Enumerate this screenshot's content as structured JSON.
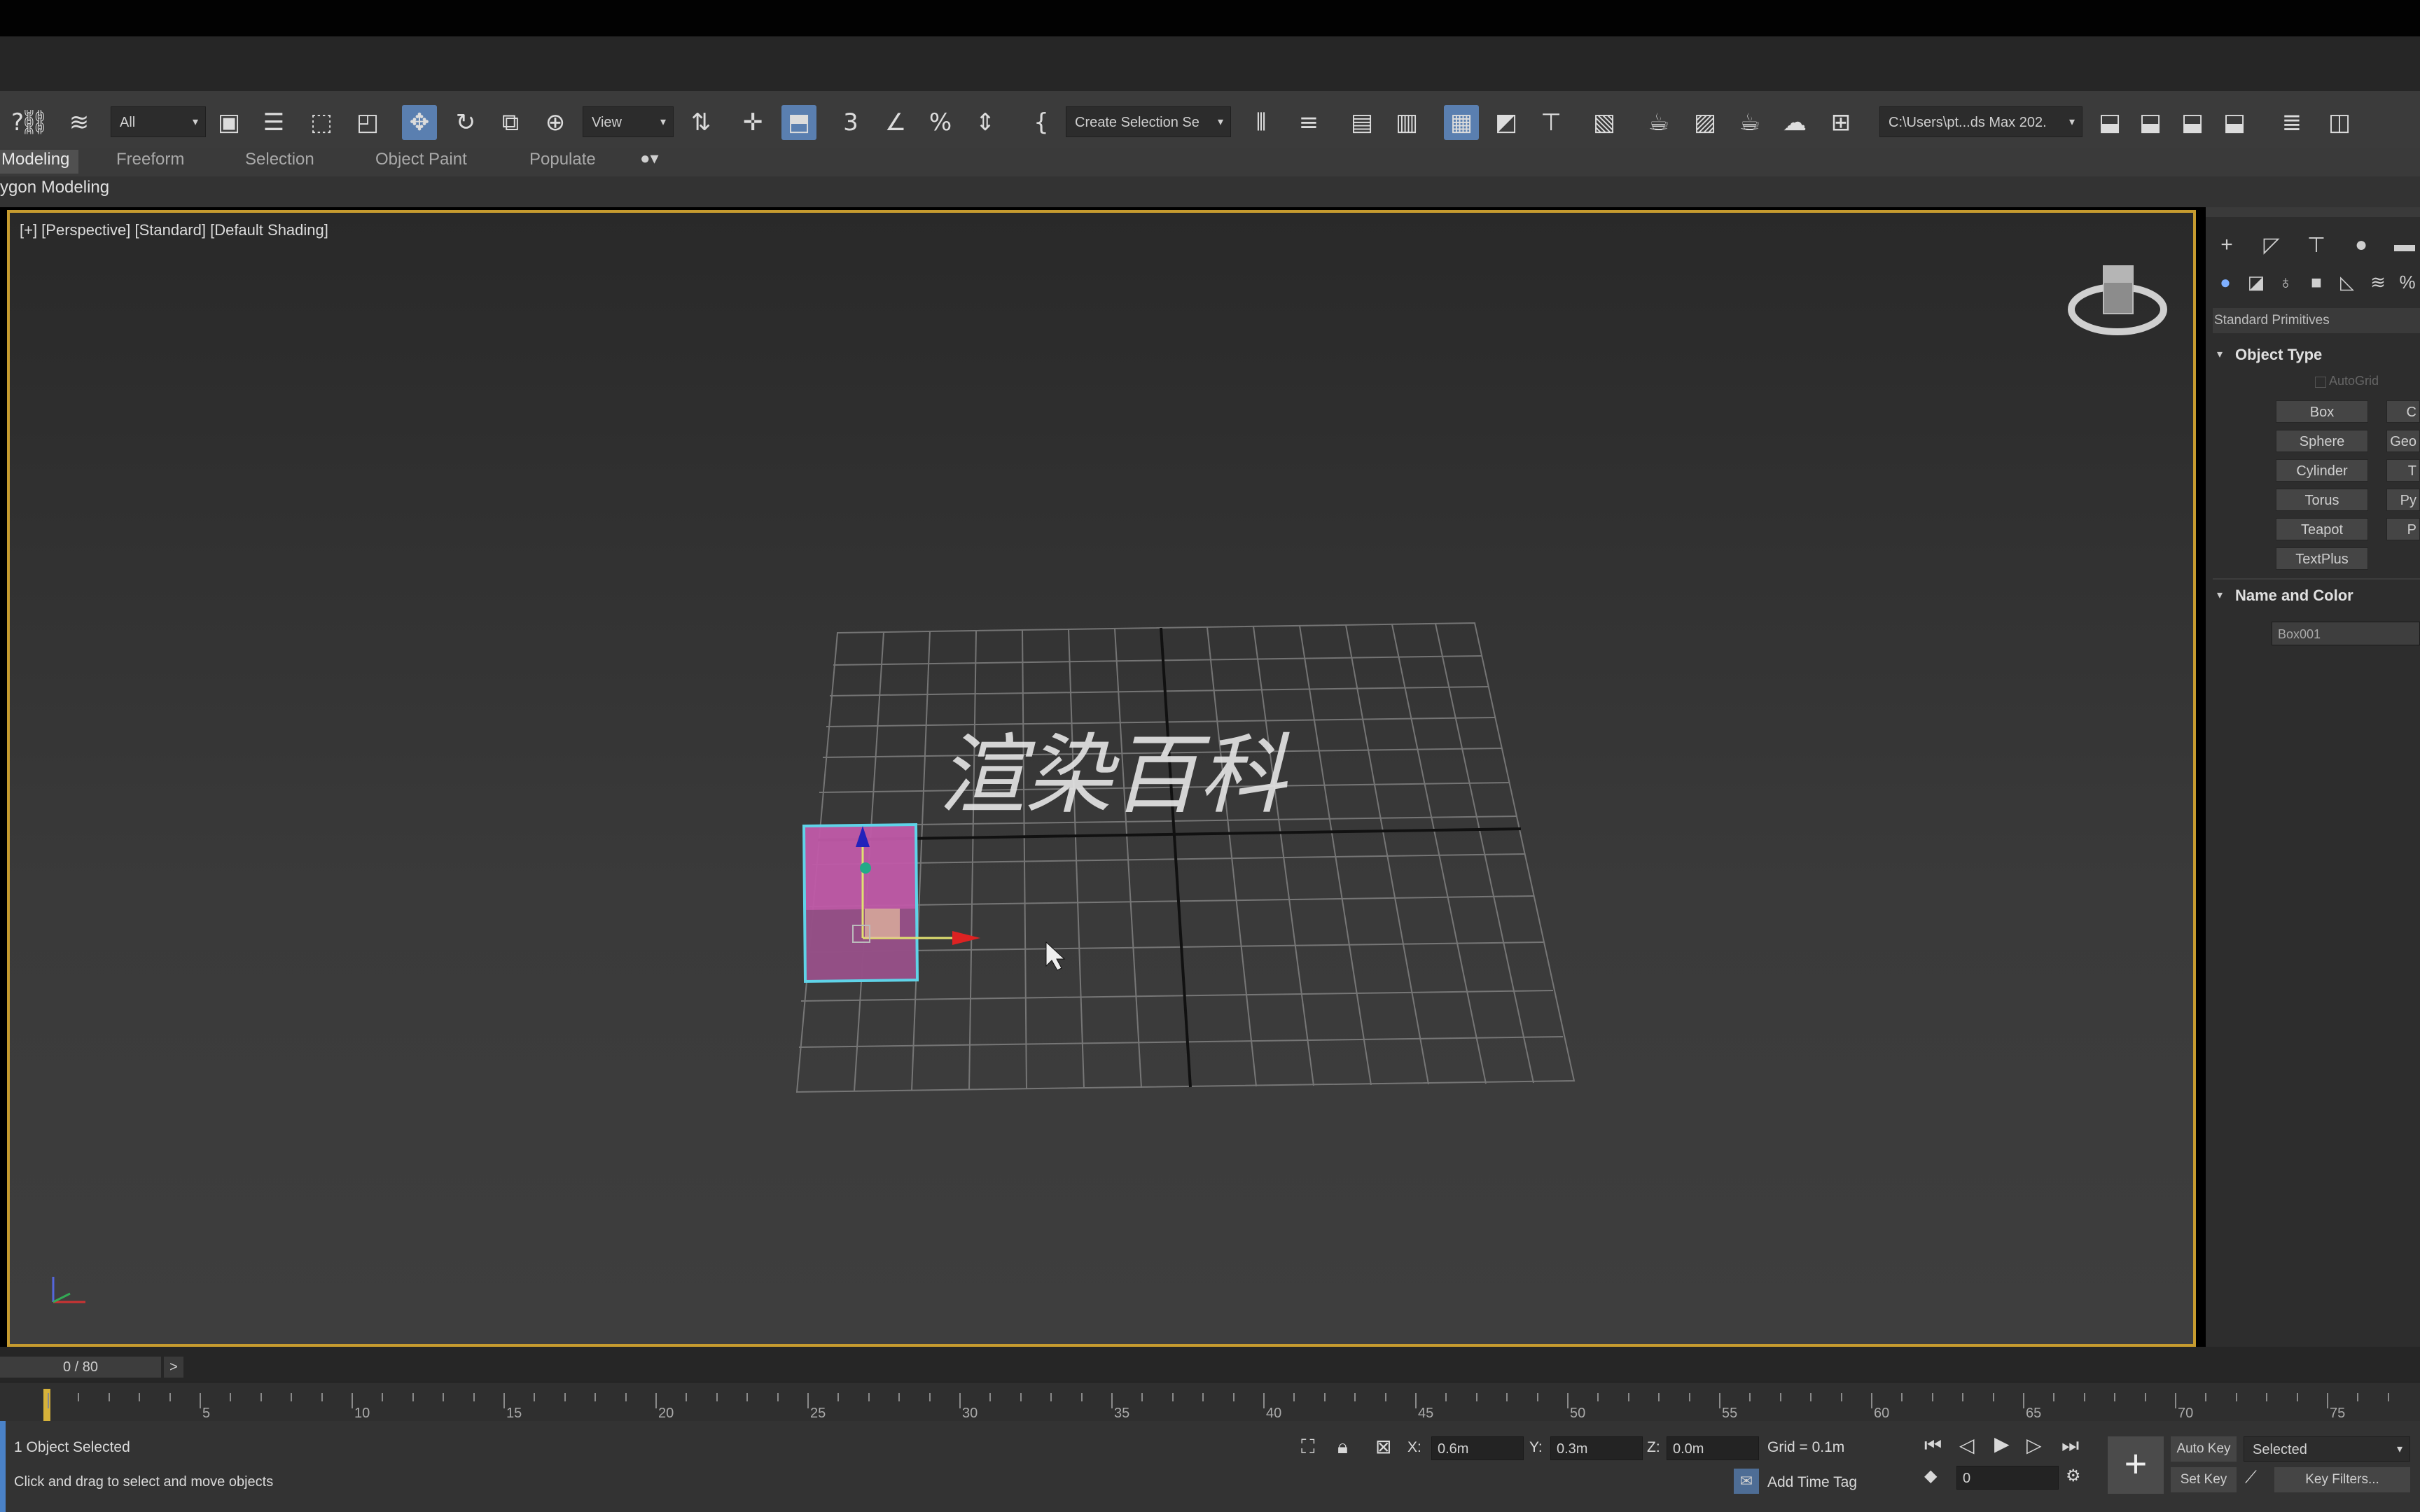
{
  "toolbar": {
    "selection_filter": "All",
    "ref_coord": "View",
    "named_selection": "Create Selection Se",
    "project_path": "C:\\Users\\pt...ds Max 202."
  },
  "ribbon": {
    "tabs": [
      "Modeling",
      "Freeform",
      "Selection",
      "Object Paint",
      "Populate"
    ],
    "subtitle": "ygon Modeling"
  },
  "viewport": {
    "label": "[+] [Perspective] [Standard] [Default Shading]",
    "watermark": "渲染百科"
  },
  "command_panel": {
    "category": "Standard Primitives",
    "object_type_header": "Object Type",
    "autogrid": "AutoGrid",
    "buttons": [
      "Box",
      "Sphere",
      "Cylinder",
      "Torus",
      "Teapot",
      "TextPlus"
    ],
    "buttons_col2": [
      "C",
      "Geo",
      "T",
      "Py",
      "P"
    ],
    "name_color_header": "Name and Color",
    "object_name": "Box001"
  },
  "timeline": {
    "frame_indicator": "0 / 80",
    "ticks": [
      "5",
      "10",
      "15",
      "20",
      "25",
      "30",
      "35",
      "40",
      "45",
      "50",
      "55",
      "60",
      "65",
      "70",
      "75"
    ]
  },
  "status": {
    "selection": "1 Object Selected",
    "prompt": "Click and drag to select and move objects",
    "x_label": "X:",
    "x_value": "0.6m",
    "y_label": "Y:",
    "y_value": "0.3m",
    "z_label": "Z:",
    "z_value": "0.0m",
    "grid": "Grid = 0.1m",
    "add_time_tag": "Add Time Tag",
    "auto_key": "Auto Key",
    "set_key": "Set Key",
    "key_mode": "Selected",
    "key_filters": "Key Filters...",
    "frame": "0"
  },
  "colors": {
    "viewport_border": "#c69b2f",
    "active_tool": "#5a7fb0",
    "box_fill": "#c05aa8",
    "selection_outline": "#5fd3e8"
  }
}
